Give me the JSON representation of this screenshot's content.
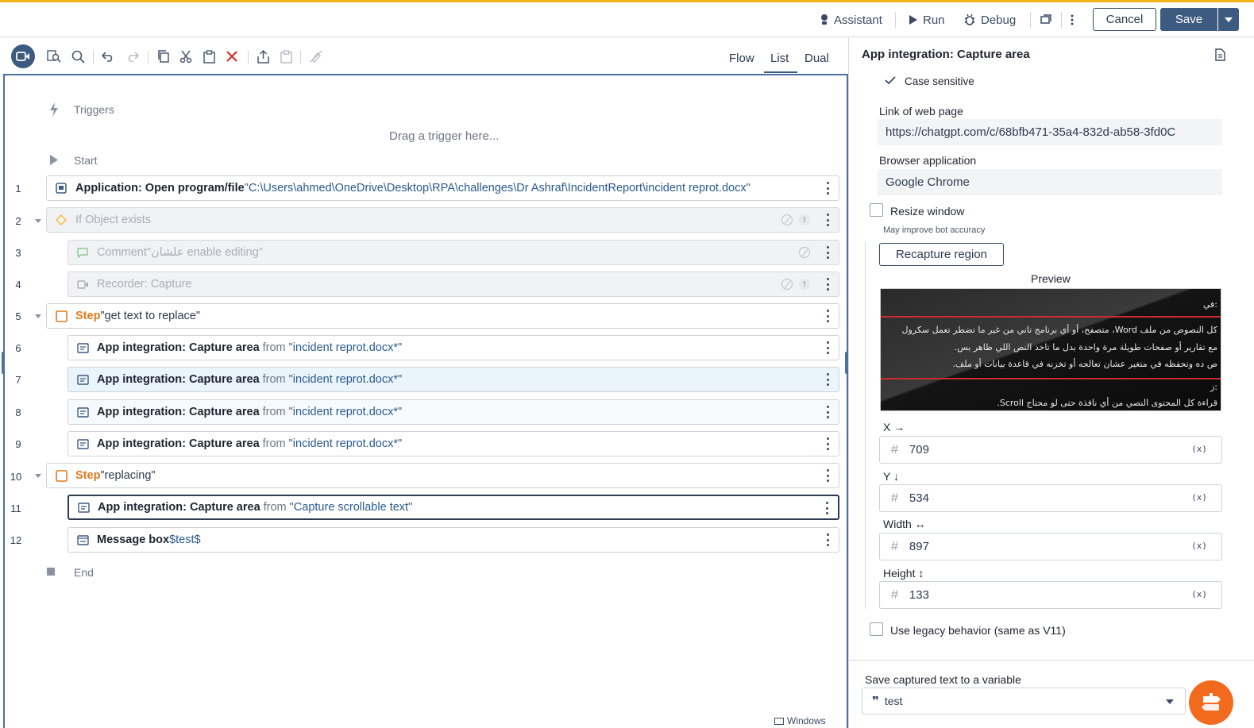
{
  "header": {
    "assistant": "Assistant",
    "run": "Run",
    "debug": "Debug",
    "cancel": "Cancel",
    "save": "Save"
  },
  "view_tabs": {
    "flow": "Flow",
    "list": "List",
    "dual": "Dual",
    "active": "List"
  },
  "flow": {
    "triggers": "Triggers",
    "drag_trigger": "Drag a trigger here...",
    "start": "Start",
    "end": "End",
    "windows": "Windows",
    "rows": [
      {
        "num": "1",
        "kw": "Application: Open program/file",
        "q1": " \"",
        "str": "C:\\Users\\ahmed\\OneDrive\\Desktop\\RPA\\challenges\\Dr Ashraf\\IncidentReport\\incident reprot.docx",
        "q2": "\""
      },
      {
        "num": "2",
        "kw": "If Object exists"
      },
      {
        "num": "3",
        "kw": "Comment",
        "str": " \"علشان enable editing\""
      },
      {
        "num": "4",
        "kw": "Recorder: Capture"
      },
      {
        "num": "5",
        "step": "Step",
        "str": " \"get text to replace\""
      },
      {
        "num": "6",
        "kw": "App integration: Capture area",
        "from": "from",
        "q1": "\"",
        "str": "incident reprot.docx*",
        "q2": "\""
      },
      {
        "num": "7",
        "kw": "App integration: Capture area",
        "from": "from",
        "q1": "\"",
        "str": "incident reprot.docx*",
        "q2": "\""
      },
      {
        "num": "8",
        "kw": "App integration: Capture area",
        "from": "from",
        "q1": "\"",
        "str": "incident reprot.docx*",
        "q2": "\""
      },
      {
        "num": "9",
        "kw": "App integration: Capture area",
        "from": "from",
        "q1": "\"",
        "str": "incident reprot.docx*",
        "q2": "\""
      },
      {
        "num": "10",
        "step": "Step",
        "str": " \"replacing\""
      },
      {
        "num": "11",
        "kw": "App integration: Capture area",
        "from": "from",
        "q1": "\"",
        "str": "Capture scrollable text",
        "q2": "\""
      },
      {
        "num": "12",
        "kw": "Message box",
        "str": " $test$"
      }
    ]
  },
  "panel": {
    "title": "App integration: Capture area",
    "case_sensitive": "Case sensitive",
    "link_label": "Link of web page",
    "link_value": "https://chatgpt.com/c/68bfb471-35a4-832d-ab58-3fd0C",
    "browser_label": "Browser application",
    "browser_value": "Google Chrome",
    "resize_label": "Resize window",
    "resize_hint": "May improve bot accuracy",
    "recapture": "Recapture region",
    "preview_label": "Preview",
    "preview_lines": [
      ":في",
      "كل النصوص من ملف Word، متصفح، أو أي برنامج تاني من غير ما تضطر تعمل سكرول",
      "مع تقارير أو صفحات طويلة مرة واحدة بدل ما تاخد النص اللي ظاهر بس.",
      "ص ده وتحفظه في متغير عشان تعالجه أو تخزنه في قاعدة بيانات أو ملف.",
      ":ز",
      "قراءة كل المحتوى النصي من أي نافذة حتى لو محتاج Scroll."
    ],
    "x_label": "X →",
    "x_value": "709",
    "y_label": "Y ↓",
    "y_value": "534",
    "w_label": "Width ↔",
    "w_value": "897",
    "h_label": "Height ↕",
    "h_value": "133",
    "var_token": "(x)",
    "legacy_label": "Use legacy behavior (same as V11)",
    "save_var_label": "Save captured text to a variable",
    "save_var_value": "test"
  },
  "colors": {
    "accent": "#3d5a80",
    "step": "#e07a1f",
    "string": "#2a5a8f",
    "top_line": "#f2b418",
    "fab": "#f26a1e"
  }
}
